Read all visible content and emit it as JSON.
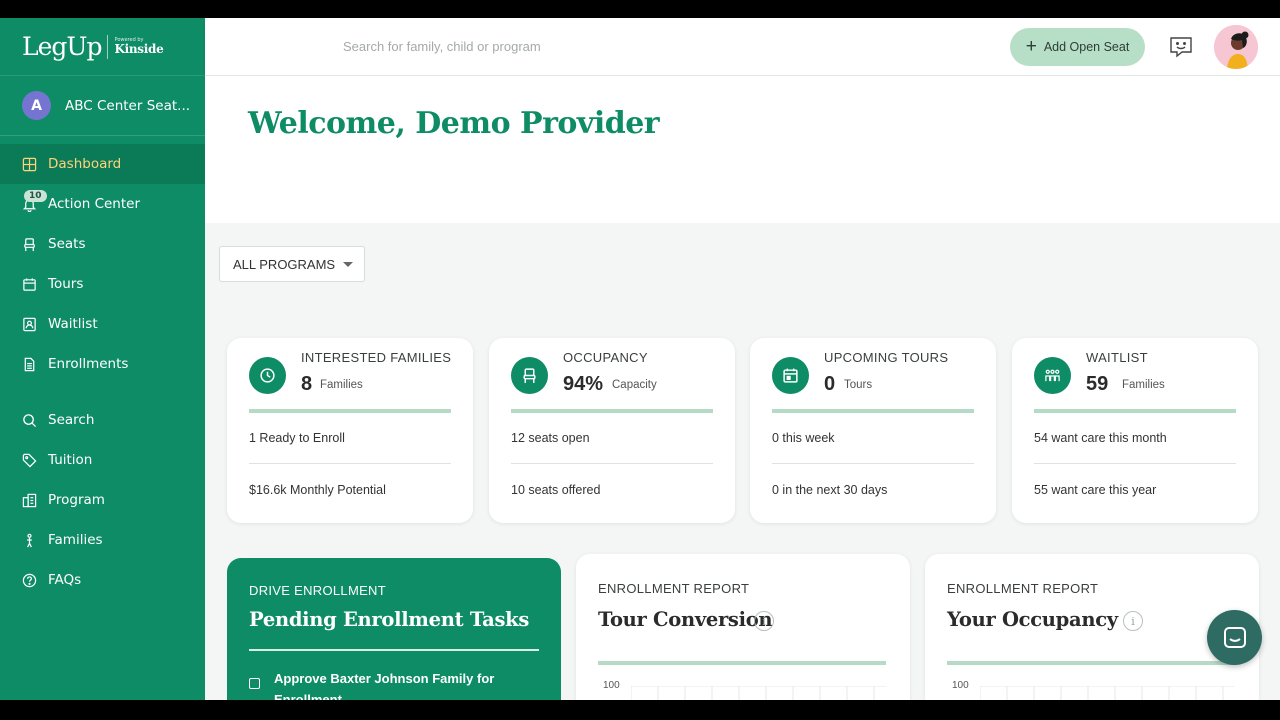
{
  "brand": {
    "logo": "LegUp",
    "powered_by": "Powered by",
    "partner": "Kinside"
  },
  "account": {
    "initial": "A",
    "name": "ABC Center Seat..."
  },
  "nav": {
    "items": [
      {
        "label": "Dashboard",
        "icon": "grid-icon",
        "active": true
      },
      {
        "label": "Action Center",
        "icon": "bell-icon",
        "badge": "10"
      },
      {
        "label": "Seats",
        "icon": "chair-icon"
      },
      {
        "label": "Tours",
        "icon": "calendar-icon"
      },
      {
        "label": "Waitlist",
        "icon": "person-card-icon"
      },
      {
        "label": "Enrollments",
        "icon": "document-icon"
      },
      {
        "label": "Search",
        "icon": "search-icon"
      },
      {
        "label": "Tuition",
        "icon": "tag-icon"
      },
      {
        "label": "Program",
        "icon": "building-icon"
      },
      {
        "label": "Families",
        "icon": "family-icon"
      },
      {
        "label": "FAQs",
        "icon": "question-icon"
      }
    ]
  },
  "topbar": {
    "search_placeholder": "Search for family, child or program",
    "add_seat_label": "Add Open Seat"
  },
  "main": {
    "welcome": "Welcome, Demo Provider",
    "program_filter": "ALL PROGRAMS"
  },
  "stats": [
    {
      "title": "INTERESTED FAMILIES",
      "value": "8",
      "unit": "Families",
      "line1": "1 Ready to Enroll",
      "line2": "$16.6k Monthly Potential",
      "icon": "clock-icon"
    },
    {
      "title": "OCCUPANCY",
      "value": "94%",
      "unit": "Capacity",
      "line1": "12 seats open",
      "line2": "10 seats offered",
      "icon": "chair-icon"
    },
    {
      "title": "UPCOMING TOURS",
      "value": "0",
      "unit": "Tours",
      "line1": "0 this week",
      "line2": "0 in the next 30 days",
      "icon": "calendar-icon"
    },
    {
      "title": "WAITLIST",
      "value": "59",
      "unit": "Families",
      "line1": "54 want care this month",
      "line2": "55 want care this year",
      "icon": "family-icon"
    }
  ],
  "tasks": {
    "eyebrow": "DRIVE ENROLLMENT",
    "title": "Pending Enrollment Tasks",
    "items": [
      "Approve Baxter Johnson Family for Enrollment"
    ]
  },
  "reports": [
    {
      "eyebrow": "ENROLLMENT REPORT",
      "title": "Tour Conversion",
      "axis_top": "100"
    },
    {
      "eyebrow": "ENROLLMENT REPORT",
      "title": "Your Occupancy",
      "axis_top": "100"
    }
  ],
  "colors": {
    "primary": "#0e8c65",
    "accent_active": "#ffd37a",
    "button_bg": "#b7dfc8",
    "bar": "#b5dac5"
  }
}
